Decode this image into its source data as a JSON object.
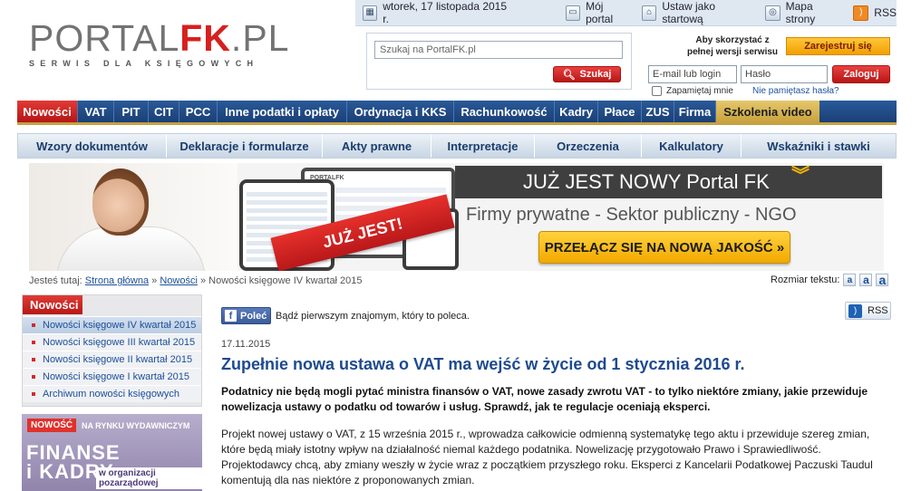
{
  "topbar": {
    "date": "wtorek, 17 listopada 2015 r.",
    "my_portal": "Mój portal",
    "set_home": "Ustaw jako startową",
    "sitemap": "Mapa strony",
    "rss": "RSS"
  },
  "logo": {
    "part1": "PORTAL",
    "part2": "FK",
    "part3": ".PL",
    "tagline": "SERWIS DLA KSIĘGOWYCH"
  },
  "search": {
    "placeholder": "Szukaj na PortalFK.pl",
    "button": "Szukaj"
  },
  "login": {
    "info": "Aby skorzystać z pełnej wersji serwisu",
    "register": "Zarejestruj się",
    "email_placeholder": "E-mail lub login",
    "password_placeholder": "Hasło",
    "login_button": "Zaloguj",
    "remember": "Zapamiętaj mnie",
    "forgot": "Nie pamiętasz hasła?"
  },
  "mainnav": {
    "items": [
      "Nowości",
      "VAT",
      "PIT",
      "CIT",
      "PCC",
      "Inne podatki i opłaty",
      "Ordynacja i KKS",
      "Rachunkowość",
      "Kadry",
      "Płace",
      "ZUS",
      "Firma",
      "Szkolenia video"
    ]
  },
  "subnav": {
    "items": [
      "Wzory dokumentów",
      "Deklaracje i formularze",
      "Akty prawne",
      "Interpretacje",
      "Orzeczenia",
      "Kalkulatory",
      "Wskaźniki i stawki"
    ]
  },
  "banner": {
    "ribbon": "JUŻ JEST!",
    "headline": "JUŻ JEST NOWY Portal FK",
    "sub": "Firmy prywatne - Sektor publiczny - NGO",
    "cta": "PRZEŁĄCZ SIĘ NA NOWĄ JAKOŚĆ »",
    "device_logo": "PORTALFK"
  },
  "breadcrumb": {
    "prefix": "Jesteś tutaj:",
    "home": "Strona główna",
    "sep": "»",
    "section": "Nowości",
    "current": "Nowości księgowe IV kwartał 2015"
  },
  "textsize": {
    "label": "Rozmiar tekstu:",
    "a": "a"
  },
  "sidebar": {
    "title": "Nowości",
    "items": [
      "Nowości księgowe IV kwartał 2015",
      "Nowości księgowe III kwartał 2015",
      "Nowości księgowe II kwartał 2015",
      "Nowości księgowe I kwartał 2015",
      "Archiwum nowości księgowych"
    ]
  },
  "side_ad": {
    "badge": "NOWOŚĆ",
    "market": "NA RYNKU WYDAWNICZYM",
    "title_line1": "FINANSE",
    "title_line2": "i KADRY",
    "subtitle": "w organizacji pozarządowej"
  },
  "social": {
    "fb_button": "Poleć",
    "fb_text": "Bądź pierwszym znajomym, który to poleca.",
    "rss": "RSS"
  },
  "article": {
    "date": "17.11.2015",
    "title": "Zupełnie nowa ustawa o VAT ma wejść w życie od 1 stycznia 2016 r.",
    "lead": "Podatnicy nie będą mogli pytać ministra finansów o VAT, nowe zasady zwrotu VAT - to tylko niektóre zmiany, jakie przewiduje nowelizacja ustawy o podatku od towarów i usług. Sprawdź, jak te regulacje oceniają eksperci.",
    "body": "Projekt nowej ustawy o VAT, z 15 września 2015 r., wprowadza całkowicie odmienną systematykę tego aktu i przewiduje szereg zmian, które będą miały istotny wpływ na działalność niemal każdego podatnika. Nowelizację przygotowało Prawo i Sprawiedliwość. Projektodawcy chcą, aby zmiany weszły w życie wraz z początkiem przyszłego roku. Eksperci z Kancelarii Podatkowej Paczuski Taudul komentują dla nas niektóre z proponowanych zmian."
  },
  "colors": {
    "brand_red": "#d6201e",
    "nav_blue": "#1a3f76",
    "link_blue": "#1d4f99",
    "accent_gold": "#f2a900"
  }
}
